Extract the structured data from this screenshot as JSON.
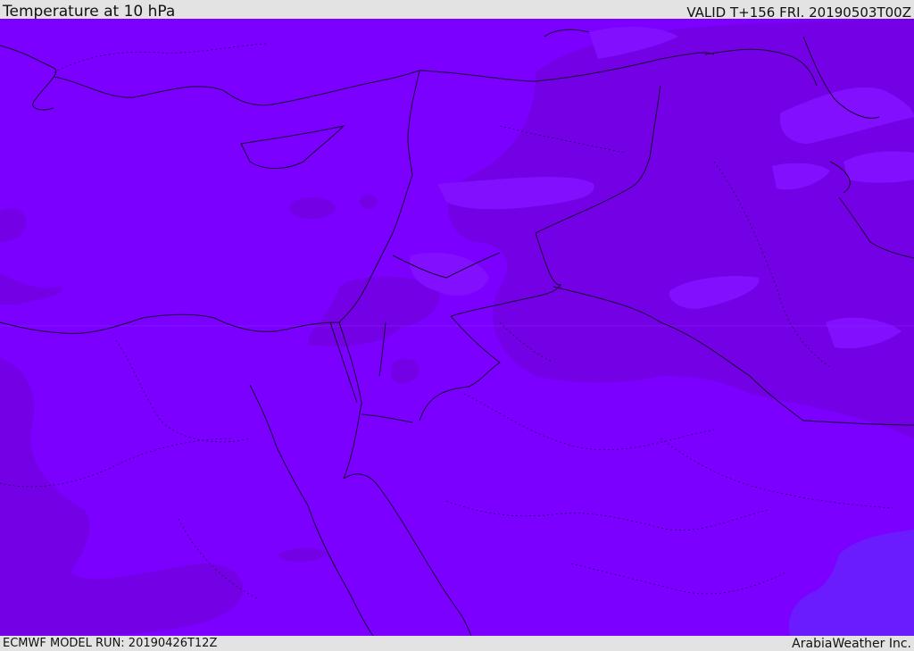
{
  "header": {
    "title": "Temperature at 10 hPa",
    "valid": "VALID T+156 FRI. 20190503T00Z"
  },
  "footer": {
    "model_run": "ECMWF MODEL RUN: 20190426T12Z",
    "credit": "ArabiaWeather Inc."
  },
  "map": {
    "colors": {
      "base": "#7b00ff",
      "darker": "#7400e6",
      "lighter": "#8210ff",
      "bluish": "#6a1cff",
      "border": "#1a0033"
    }
  }
}
